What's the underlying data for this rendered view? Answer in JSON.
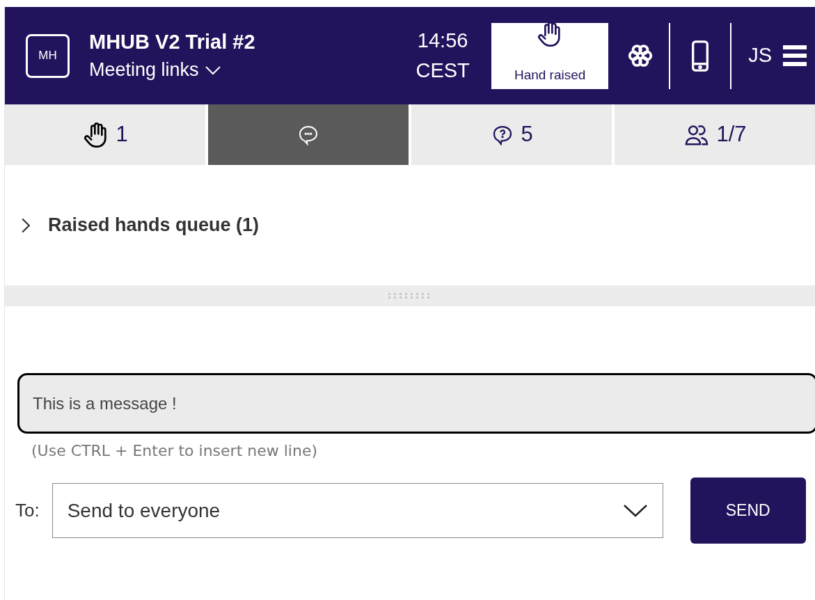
{
  "header": {
    "logo": "MH",
    "title": "MHUB V2 Trial #2",
    "links_label": "Meeting links",
    "time": "14:56",
    "timezone": "CEST",
    "hand_button": {
      "label": "Hand raised",
      "on": true
    },
    "user_initials": "JS"
  },
  "tabs": [
    {
      "kind": "hand",
      "count": "1",
      "selected": false
    },
    {
      "kind": "chat",
      "selected": true
    },
    {
      "kind": "question",
      "count": "5",
      "selected": false
    },
    {
      "kind": "people",
      "count": "1/7",
      "selected": false
    }
  ],
  "queue": {
    "title": "Raised hands queue (1)",
    "expanded": false
  },
  "composer": {
    "value": "This is a message !",
    "hint": "(Use CTRL + Enter to insert new line)",
    "to_label": "To:",
    "recipient": "Send to everyone",
    "send_label": "SEND"
  }
}
